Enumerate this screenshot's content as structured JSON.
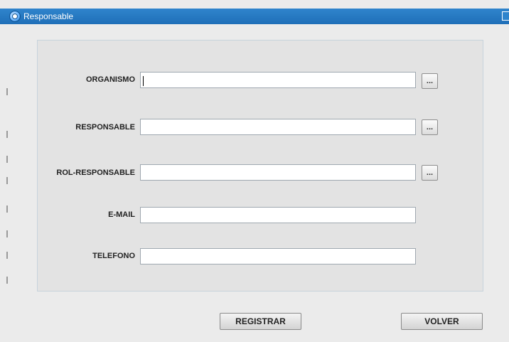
{
  "window": {
    "title": "Responsable",
    "titlebar_color": "#1f6fb8"
  },
  "form": {
    "fields": [
      {
        "label": "ORGANISMO",
        "value": "",
        "has_lookup": true
      },
      {
        "label": "RESPONSABLE",
        "value": "",
        "has_lookup": true
      },
      {
        "label": "ROL-RESPONSABLE",
        "value": "",
        "has_lookup": true
      },
      {
        "label": "E-MAIL",
        "value": "",
        "has_lookup": false
      },
      {
        "label": "TELEFONO",
        "value": "",
        "has_lookup": false
      }
    ],
    "lookup_label": "..."
  },
  "actions": {
    "register_label": "REGISTRAR",
    "back_label": "VOLVER"
  }
}
